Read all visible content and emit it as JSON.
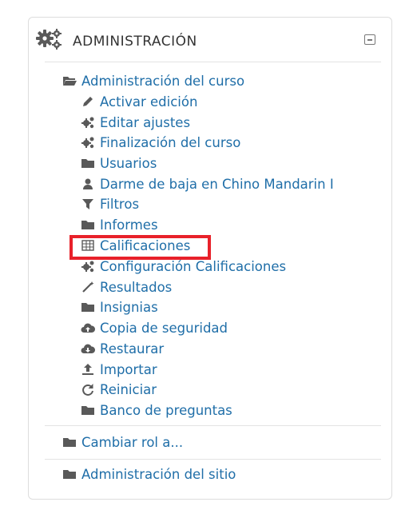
{
  "block": {
    "title": "ADMINISTRACIÓN",
    "icon": "gears-icon",
    "collapse_icon": "minus-square-icon"
  },
  "course_admin": {
    "label": "Administración del curso",
    "icon": "folder-open-icon",
    "items": [
      {
        "label": "Activar edición",
        "icon": "pencil-icon"
      },
      {
        "label": "Editar ajustes",
        "icon": "gears-icon"
      },
      {
        "label": "Finalización del curso",
        "icon": "gears-icon"
      },
      {
        "label": "Usuarios",
        "icon": "folder-icon"
      },
      {
        "label": "Darme de baja en Chino Mandarin I",
        "icon": "user-icon"
      },
      {
        "label": "Filtros",
        "icon": "filter-icon"
      },
      {
        "label": "Informes",
        "icon": "folder-icon"
      },
      {
        "label": "Calificaciones",
        "icon": "table-icon",
        "highlighted": true
      },
      {
        "label": "Configuración Calificaciones",
        "icon": "gears-icon"
      },
      {
        "label": "Resultados",
        "icon": "magic-wand-icon"
      },
      {
        "label": "Insignias",
        "icon": "folder-icon"
      },
      {
        "label": "Copia de seguridad",
        "icon": "cloud-upload-icon"
      },
      {
        "label": "Restaurar",
        "icon": "cloud-download-icon"
      },
      {
        "label": "Importar",
        "icon": "upload-icon"
      },
      {
        "label": "Reiniciar",
        "icon": "refresh-icon"
      },
      {
        "label": "Banco de preguntas",
        "icon": "folder-icon"
      }
    ]
  },
  "other_links": [
    {
      "label": "Cambiar rol a...",
      "icon": "folder-icon"
    },
    {
      "label": "Administración del sitio",
      "icon": "folder-icon"
    }
  ],
  "colors": {
    "link": "#1f6ea8",
    "icon": "#595959",
    "highlight": "#e8212a",
    "border": "#dddddd"
  }
}
